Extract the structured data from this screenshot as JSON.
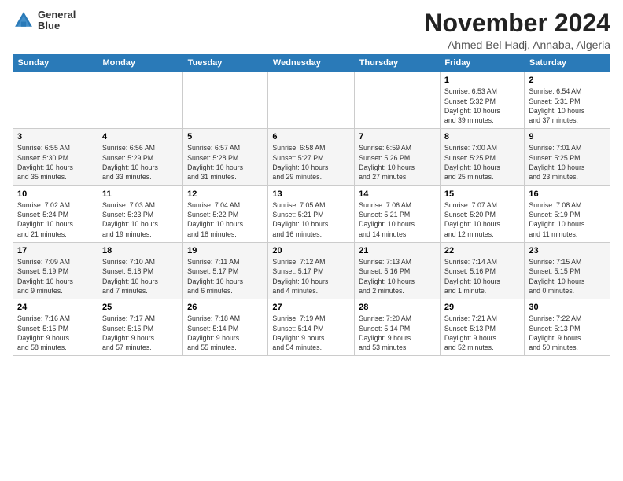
{
  "logo": {
    "text_line1": "General",
    "text_line2": "Blue"
  },
  "header": {
    "month_title": "November 2024",
    "subtitle": "Ahmed Bel Hadj, Annaba, Algeria"
  },
  "days_of_week": [
    "Sunday",
    "Monday",
    "Tuesday",
    "Wednesday",
    "Thursday",
    "Friday",
    "Saturday"
  ],
  "weeks": [
    {
      "days": [
        {
          "num": "",
          "info": ""
        },
        {
          "num": "",
          "info": ""
        },
        {
          "num": "",
          "info": ""
        },
        {
          "num": "",
          "info": ""
        },
        {
          "num": "",
          "info": ""
        },
        {
          "num": "1",
          "info": "Sunrise: 6:53 AM\nSunset: 5:32 PM\nDaylight: 10 hours\nand 39 minutes."
        },
        {
          "num": "2",
          "info": "Sunrise: 6:54 AM\nSunset: 5:31 PM\nDaylight: 10 hours\nand 37 minutes."
        }
      ]
    },
    {
      "days": [
        {
          "num": "3",
          "info": "Sunrise: 6:55 AM\nSunset: 5:30 PM\nDaylight: 10 hours\nand 35 minutes."
        },
        {
          "num": "4",
          "info": "Sunrise: 6:56 AM\nSunset: 5:29 PM\nDaylight: 10 hours\nand 33 minutes."
        },
        {
          "num": "5",
          "info": "Sunrise: 6:57 AM\nSunset: 5:28 PM\nDaylight: 10 hours\nand 31 minutes."
        },
        {
          "num": "6",
          "info": "Sunrise: 6:58 AM\nSunset: 5:27 PM\nDaylight: 10 hours\nand 29 minutes."
        },
        {
          "num": "7",
          "info": "Sunrise: 6:59 AM\nSunset: 5:26 PM\nDaylight: 10 hours\nand 27 minutes."
        },
        {
          "num": "8",
          "info": "Sunrise: 7:00 AM\nSunset: 5:25 PM\nDaylight: 10 hours\nand 25 minutes."
        },
        {
          "num": "9",
          "info": "Sunrise: 7:01 AM\nSunset: 5:25 PM\nDaylight: 10 hours\nand 23 minutes."
        }
      ]
    },
    {
      "days": [
        {
          "num": "10",
          "info": "Sunrise: 7:02 AM\nSunset: 5:24 PM\nDaylight: 10 hours\nand 21 minutes."
        },
        {
          "num": "11",
          "info": "Sunrise: 7:03 AM\nSunset: 5:23 PM\nDaylight: 10 hours\nand 19 minutes."
        },
        {
          "num": "12",
          "info": "Sunrise: 7:04 AM\nSunset: 5:22 PM\nDaylight: 10 hours\nand 18 minutes."
        },
        {
          "num": "13",
          "info": "Sunrise: 7:05 AM\nSunset: 5:21 PM\nDaylight: 10 hours\nand 16 minutes."
        },
        {
          "num": "14",
          "info": "Sunrise: 7:06 AM\nSunset: 5:21 PM\nDaylight: 10 hours\nand 14 minutes."
        },
        {
          "num": "15",
          "info": "Sunrise: 7:07 AM\nSunset: 5:20 PM\nDaylight: 10 hours\nand 12 minutes."
        },
        {
          "num": "16",
          "info": "Sunrise: 7:08 AM\nSunset: 5:19 PM\nDaylight: 10 hours\nand 11 minutes."
        }
      ]
    },
    {
      "days": [
        {
          "num": "17",
          "info": "Sunrise: 7:09 AM\nSunset: 5:19 PM\nDaylight: 10 hours\nand 9 minutes."
        },
        {
          "num": "18",
          "info": "Sunrise: 7:10 AM\nSunset: 5:18 PM\nDaylight: 10 hours\nand 7 minutes."
        },
        {
          "num": "19",
          "info": "Sunrise: 7:11 AM\nSunset: 5:17 PM\nDaylight: 10 hours\nand 6 minutes."
        },
        {
          "num": "20",
          "info": "Sunrise: 7:12 AM\nSunset: 5:17 PM\nDaylight: 10 hours\nand 4 minutes."
        },
        {
          "num": "21",
          "info": "Sunrise: 7:13 AM\nSunset: 5:16 PM\nDaylight: 10 hours\nand 2 minutes."
        },
        {
          "num": "22",
          "info": "Sunrise: 7:14 AM\nSunset: 5:16 PM\nDaylight: 10 hours\nand 1 minute."
        },
        {
          "num": "23",
          "info": "Sunrise: 7:15 AM\nSunset: 5:15 PM\nDaylight: 10 hours\nand 0 minutes."
        }
      ]
    },
    {
      "days": [
        {
          "num": "24",
          "info": "Sunrise: 7:16 AM\nSunset: 5:15 PM\nDaylight: 9 hours\nand 58 minutes."
        },
        {
          "num": "25",
          "info": "Sunrise: 7:17 AM\nSunset: 5:15 PM\nDaylight: 9 hours\nand 57 minutes."
        },
        {
          "num": "26",
          "info": "Sunrise: 7:18 AM\nSunset: 5:14 PM\nDaylight: 9 hours\nand 55 minutes."
        },
        {
          "num": "27",
          "info": "Sunrise: 7:19 AM\nSunset: 5:14 PM\nDaylight: 9 hours\nand 54 minutes."
        },
        {
          "num": "28",
          "info": "Sunrise: 7:20 AM\nSunset: 5:14 PM\nDaylight: 9 hours\nand 53 minutes."
        },
        {
          "num": "29",
          "info": "Sunrise: 7:21 AM\nSunset: 5:13 PM\nDaylight: 9 hours\nand 52 minutes."
        },
        {
          "num": "30",
          "info": "Sunrise: 7:22 AM\nSunset: 5:13 PM\nDaylight: 9 hours\nand 50 minutes."
        }
      ]
    }
  ]
}
